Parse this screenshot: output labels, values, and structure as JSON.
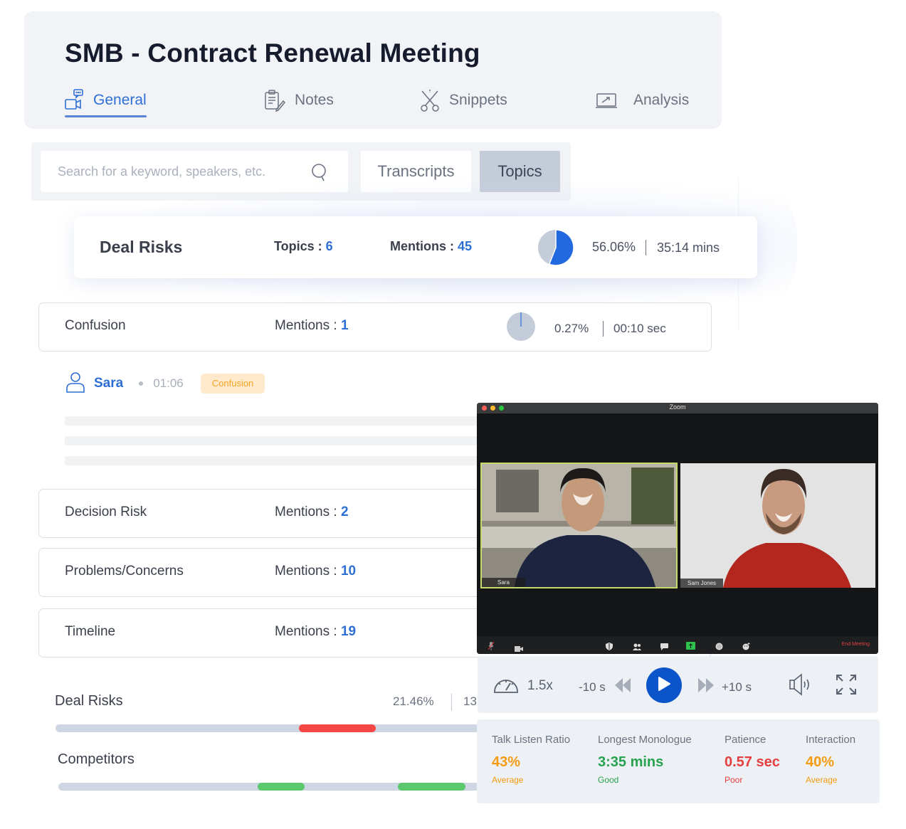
{
  "header": {
    "title": "SMB - Contract Renewal Meeting",
    "tabs": [
      {
        "label": "General",
        "icon": "video-chat-icon",
        "active": true
      },
      {
        "label": "Notes",
        "icon": "clipboard-pen-icon",
        "active": false
      },
      {
        "label": "Snippets",
        "icon": "scissors-icon",
        "active": false
      },
      {
        "label": "Analysis",
        "icon": "chart-board-icon",
        "active": false
      }
    ]
  },
  "search": {
    "placeholder": "Search for a keyword, speakers, etc.",
    "value": ""
  },
  "view_toggle": {
    "options": [
      "Transcripts",
      "Topics"
    ],
    "selected": "Topics"
  },
  "summary": {
    "title": "Deal Risks",
    "topics_label": "Topics : ",
    "topics_count": "6",
    "mentions_label": "Mentions : ",
    "mentions_count": "45",
    "share_percent": "56.06%",
    "share_fraction": 0.5606,
    "duration": "35:14 mins"
  },
  "topics": [
    {
      "name": "Confusion",
      "mentions_label": "Mentions : ",
      "mentions": "1",
      "share_percent": "0.27%",
      "share_fraction": 0.0027,
      "duration": "00:10 sec",
      "expanded": true
    },
    {
      "name": "Decision Risk",
      "mentions_label": "Mentions : ",
      "mentions": "2"
    },
    {
      "name": "Problems/Concerns",
      "mentions_label": "Mentions : ",
      "mentions": "10"
    },
    {
      "name": "Timeline",
      "mentions_label": "Mentions : ",
      "mentions": "19"
    }
  ],
  "mention": {
    "speaker": "Sara",
    "timestamp": "01:06",
    "tag": "Confusion"
  },
  "timelines": [
    {
      "label": "Deal Risks",
      "percent": "21.46%",
      "duration_partial": "13",
      "segments": [
        {
          "start": 0.57,
          "end": 0.75,
          "color": "#f44744"
        }
      ]
    },
    {
      "label": "Competitors",
      "segments": [
        {
          "start": 0.47,
          "end": 0.58,
          "color": "#5bc86e"
        },
        {
          "start": 0.8,
          "end": 0.96,
          "color": "#5bc86e"
        }
      ]
    }
  ],
  "video": {
    "window_title": "Zoom",
    "participants": [
      {
        "name": "Sara",
        "active_speaker": true
      },
      {
        "name": "Sam Jones",
        "active_speaker": false
      }
    ],
    "controls": [
      "mic-muted-icon",
      "camera-icon",
      "security-icon",
      "participants-icon",
      "chat-icon",
      "share-screen-icon",
      "record-icon",
      "reactions-icon"
    ],
    "end_meeting_label": "End Meeting"
  },
  "player": {
    "speed": "1.5x",
    "rewind_label": "-10 s",
    "forward_label": "+10 s",
    "accent_color": "#0b54c9"
  },
  "metrics": [
    {
      "label": "Talk Listen Ratio",
      "value": "43%",
      "rating": "Average",
      "color": "#f39c12"
    },
    {
      "label": "Longest Monologue",
      "value": "3:35 mins",
      "rating": "Good",
      "color": "#27a24f"
    },
    {
      "label": "Patience",
      "value": "0.57 sec",
      "rating": "Poor",
      "color": "#e53e3e"
    },
    {
      "label": "Interaction",
      "value": "40%",
      "rating": "Average",
      "color": "#f39c12"
    }
  ]
}
